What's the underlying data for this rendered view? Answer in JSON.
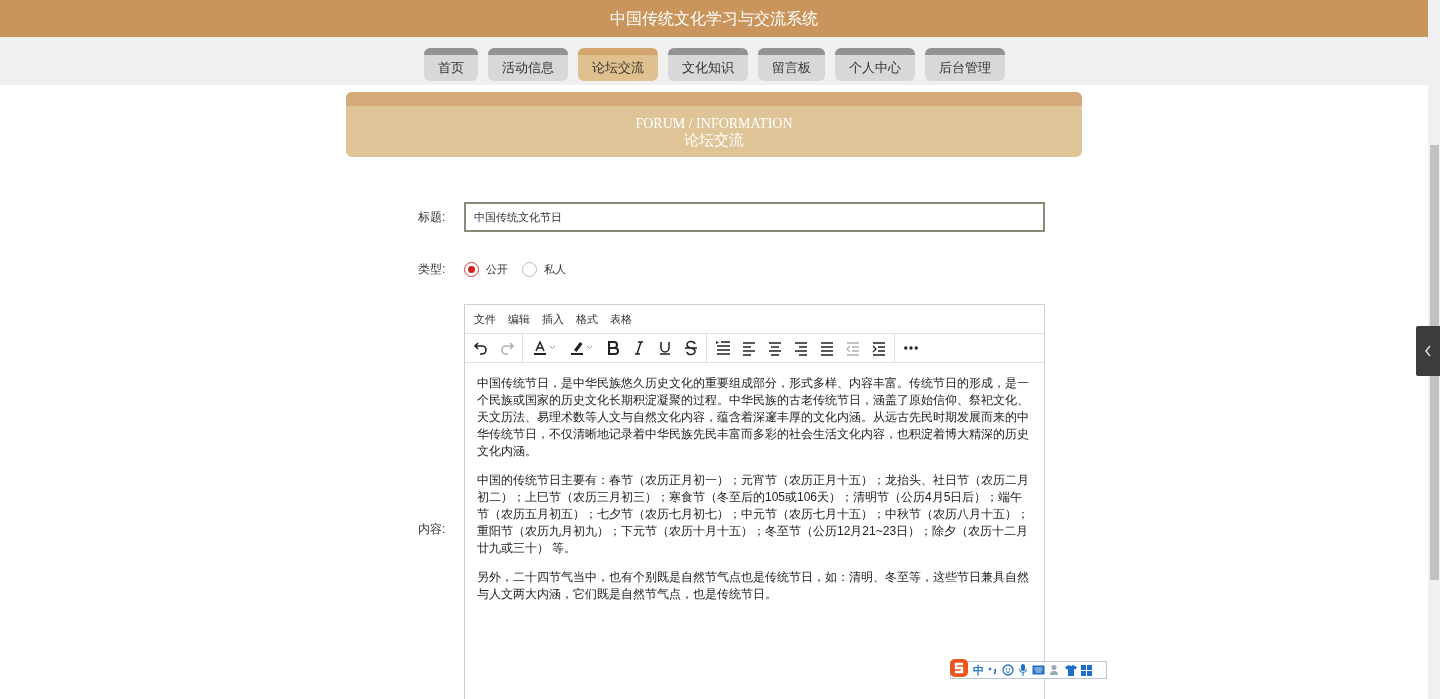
{
  "header": {
    "title": "中国传统文化学习与交流系统"
  },
  "nav": [
    {
      "label": "首页",
      "selected": false
    },
    {
      "label": "活动信息",
      "selected": false
    },
    {
      "label": "论坛交流",
      "selected": true
    },
    {
      "label": "文化知识",
      "selected": false
    },
    {
      "label": "留言板",
      "selected": false
    },
    {
      "label": "个人中心",
      "selected": false
    },
    {
      "label": "后台管理",
      "selected": false
    }
  ],
  "banner": {
    "english": "FORUM / INFORMATION",
    "title": "论坛交流"
  },
  "form": {
    "title_label": "标题:",
    "title_value": "中国传统文化节日",
    "type_label": "类型:",
    "type_options": [
      {
        "label": "公开",
        "selected": true
      },
      {
        "label": "私人",
        "selected": false
      }
    ],
    "content_label": "内容:"
  },
  "editor": {
    "menu": [
      "文件",
      "编辑",
      "插入",
      "格式",
      "表格"
    ],
    "toolbar": [
      [
        {
          "kind": "undo",
          "disabled": false
        },
        {
          "kind": "redo",
          "disabled": true
        }
      ],
      [
        {
          "kind": "text-color",
          "disabled": false
        },
        {
          "kind": "highlight",
          "disabled": false
        },
        {
          "kind": "bold",
          "disabled": false
        },
        {
          "kind": "italic",
          "disabled": false
        },
        {
          "kind": "underline",
          "disabled": false
        },
        {
          "kind": "strikethrough",
          "disabled": false
        }
      ],
      [
        {
          "kind": "line-height",
          "disabled": false
        },
        {
          "kind": "align-left",
          "disabled": false
        },
        {
          "kind": "align-center",
          "disabled": false
        },
        {
          "kind": "align-right",
          "disabled": false
        },
        {
          "kind": "justify",
          "disabled": false
        },
        {
          "kind": "outdent",
          "disabled": true
        },
        {
          "kind": "indent",
          "disabled": false
        }
      ],
      [
        {
          "kind": "more",
          "disabled": false
        }
      ]
    ],
    "paragraphs": [
      "中国传统节日，是中华民族悠久历史文化的重要组成部分，形式多样、内容丰富。传统节日的形成，是一个民族或国家的历史文化长期积淀凝聚的过程。中华民族的古老传统节日，涵盖了原始信仰、祭祀文化、天文历法、易理术数等人文与自然文化内容，蕴含着深邃丰厚的文化内涵。从远古先民时期发展而来的中华传统节日，不仅清晰地记录着中华民族先民丰富而多彩的社会生活文化内容，也积淀着博大精深的历史文化内涵。",
      "中国的传统节日主要有：春节（农历正月初一）；元宵节（农历正月十五）；龙抬头、社日节（农历二月初二）；上巳节（农历三月初三）；寒食节（冬至后的105或106天）；清明节（公历4月5日后）；端午节（农历五月初五）；七夕节（农历七月初七）；中元节（农历七月十五）；中秋节（农历八月十五）；重阳节（农历九月初九）；下元节（农历十月十五）；冬至节（公历12月21~23日）；除夕（农历十二月廿九或三十） 等。",
      "另外，二十四节气当中，也有个别既是自然节气点也是传统节日，如：清明、冬至等，这些节日兼具自然与人文两大内涵，它们既是自然节气点，也是传统节日。"
    ]
  },
  "ime_toolbar": {
    "mode": "中"
  }
}
